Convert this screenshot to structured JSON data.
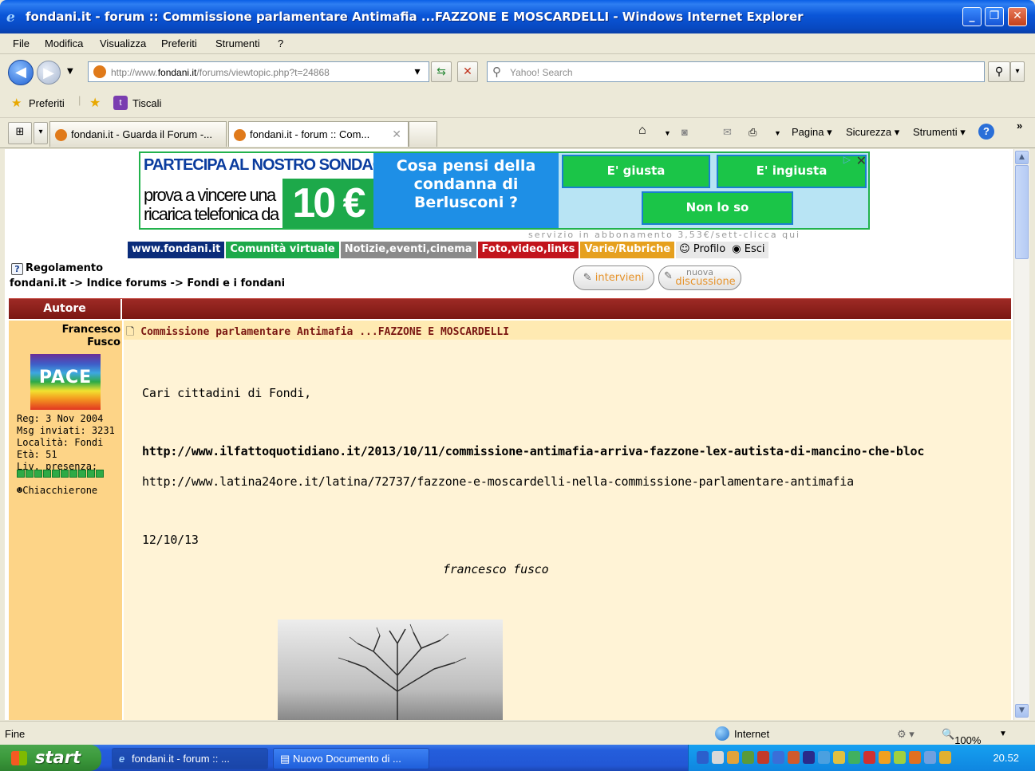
{
  "window": {
    "title": "fondani.it - forum :: Commissione parlamentare Antimafia ...FAZZONE E MOSCARDELLI - Windows Internet Explorer"
  },
  "menu": [
    "File",
    "Modifica",
    "Visualizza",
    "Preferiti",
    "Strumenti",
    "?"
  ],
  "address": {
    "url_prefix": "http://www.",
    "url_domain": "fondani.it",
    "url_path": "/forums/viewtopic.php?t=24868",
    "search_placeholder": "Yahoo! Search"
  },
  "favorites": {
    "preferiti": "Preferiti",
    "tiscali": "Tiscali"
  },
  "tabs": [
    {
      "label": "fondani.it - Guarda il Forum -..."
    },
    {
      "label": "fondani.it - forum :: Com..."
    }
  ],
  "commands": {
    "pagina": "Pagina",
    "sicurezza": "Sicurezza",
    "strumenti": "Strumenti",
    "more": "»"
  },
  "banner": {
    "headline": "PARTECIPA AL NOSTRO SONDAGGIO!",
    "line1": "prova a vincere una",
    "line2": "ricarica telefonica da",
    "price": "10 €",
    "question": "Cosa pensi della condanna di Berlusconi ?",
    "opt1": "E' giusta",
    "opt2": "E' ingiusta",
    "opt3": "Non lo so",
    "footer": "servizio in abbonamento 3,53€/sett-clicca qui"
  },
  "nav": [
    "www.fondani.it",
    "Comunità virtuale",
    "Notizie,eventi,cinema",
    "Foto,video,links",
    "Varie/Rubriche"
  ],
  "nav_colors": [
    "#0A2C7A",
    "#1DA94A",
    "#8A8A8A",
    "#C2141C",
    "#E6A01E"
  ],
  "profile": "Profilo",
  "logout": "Esci",
  "rules": "Regolamento",
  "breadcrumb": "fondani.it -> Indice forums -> Fondi e i fondani",
  "buttons": {
    "reply": "intervieni",
    "new_top": "nuova",
    "new_bottom": "discussione"
  },
  "table": {
    "author_header": "Autore"
  },
  "author": {
    "name1": "Francesco",
    "name2": "Fusco",
    "avatar_text": "PACE",
    "reg": "Reg: 3 Nov 2004",
    "posts": "Msg inviati: 3231",
    "location": "Località: Fondi",
    "age": "Età: 51",
    "presence": "Liv. presenza:",
    "rank": "Chiacchierone"
  },
  "post": {
    "title": "Commissione parlamentare Antimafia ...FAZZONE E MOSCARDELLI",
    "greeting": "Cari cittadini di Fondi,",
    "link1": "http://www.ilfattoquotidiano.it/2013/10/11/commissione-antimafia-arriva-fazzone-lex-autista-di-mancino-che-bloc",
    "link2": "http://www.latina24ore.it/latina/72737/fazzone-e-moscardelli-nella-commissione-parlamentare-antimafia",
    "date": "12/10/13",
    "signature": "francesco fusco"
  },
  "status": {
    "left": "Fine",
    "zone": "Internet",
    "zoom": "100%"
  },
  "taskbar": {
    "start": "start",
    "task1": "fondani.it - forum :: ...",
    "task2": "Nuovo Documento di ...",
    "clock": "20.52"
  }
}
